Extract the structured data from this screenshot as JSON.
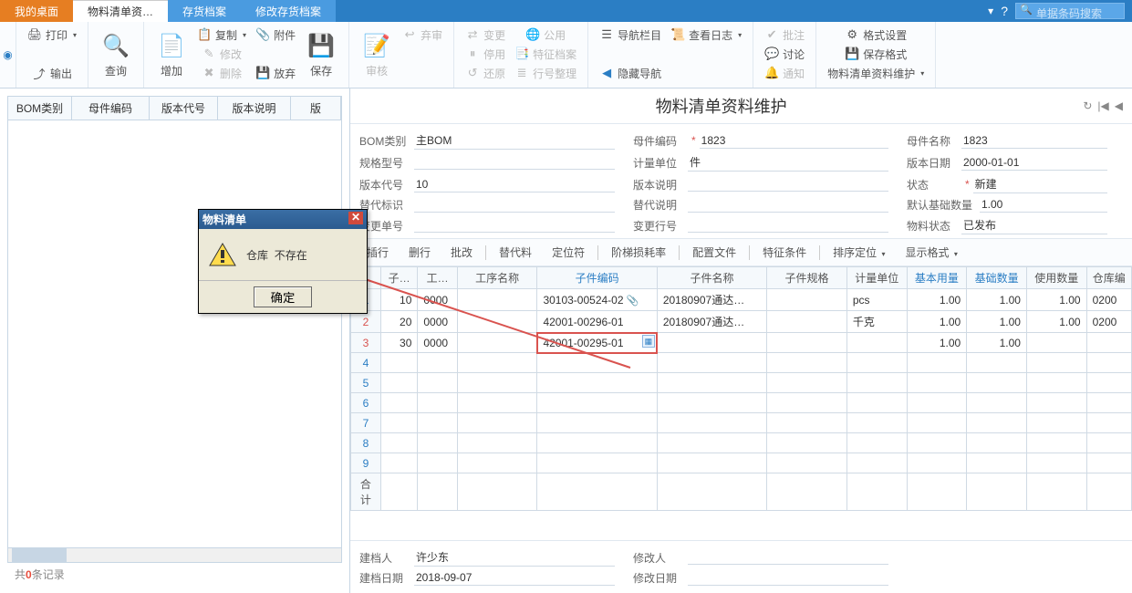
{
  "tabs": {
    "desktop": "我的桌面",
    "bom": "物料清单资…",
    "inventory": "存货档案",
    "modify_inventory": "修改存货档案"
  },
  "search_placeholder": "单据条码搜索",
  "ribbon": {
    "print": "打印",
    "output": "输出",
    "query": "查询",
    "add": "增加",
    "copy": "复制",
    "modify": "修改",
    "delete": "删除",
    "attach": "附件",
    "save": "保存",
    "abandon": "放弃",
    "audit": "审核",
    "discard": "弃审",
    "change": "变更",
    "stop": "停用",
    "restore": "还原",
    "public": "公用",
    "feature_file": "特征档案",
    "row_arrange": "行号整理",
    "nav_bar": "导航栏目",
    "view_log": "查看日志",
    "hide_nav": "隐藏导航",
    "batch_approve": "批注",
    "discuss": "讨论",
    "notify": "通知",
    "format_setting": "格式设置",
    "save_format": "保存格式",
    "bom_maintain": "物料清单资料维护"
  },
  "left_columns": {
    "bom_type": "BOM类别",
    "parent_code": "母件编码",
    "version_code": "版本代号",
    "version_desc": "版本说明",
    "ver": "版"
  },
  "left_footer": {
    "prefix": "共",
    "count": "0",
    "suffix": "条记录"
  },
  "dialog": {
    "title": "物料清单",
    "msg1": "仓库",
    "msg2": "不存在",
    "ok": "确定"
  },
  "page_title": "物料清单资料维护",
  "form": {
    "bom_type_label": "BOM类别",
    "bom_type_value": "主BOM",
    "parent_code_label": "母件编码",
    "parent_code_value": "1823",
    "parent_name_label": "母件名称",
    "parent_name_value": "1823",
    "spec_label": "规格型号",
    "unit_label": "计量单位",
    "unit_value": "件",
    "ver_date_label": "版本日期",
    "ver_date_value": "2000-01-01",
    "ver_code_label": "版本代号",
    "ver_code_value": "10",
    "ver_desc_label": "版本说明",
    "status_label": "状态",
    "status_value": "新建",
    "alt_label": "替代标识",
    "alt_desc_label": "替代说明",
    "base_qty_label": "默认基础数量",
    "base_qty_value": "1.00",
    "change_no_label": "变更单号",
    "change_row_label": "变更行号",
    "material_status_label": "物料状态",
    "material_status_value": "已发布"
  },
  "detail_toolbar": {
    "insert": "插行",
    "delete": "删行",
    "batch": "批改",
    "alt": "替代料",
    "locator": "定位符",
    "loss": "阶梯损耗率",
    "config": "配置文件",
    "feature": "特征条件",
    "sort": "排序定位",
    "display": "显示格式"
  },
  "detail_columns": {
    "child": "子…",
    "proc": "工…",
    "proc_name": "工序名称",
    "child_code": "子件编码",
    "child_name": "子件名称",
    "child_spec": "子件规格",
    "unit": "计量单位",
    "base_use": "基本用量",
    "base_qty": "基础数量",
    "use_qty": "使用数量",
    "wh_code": "仓库编"
  },
  "rows": [
    {
      "n": "1",
      "red": false,
      "c": "10",
      "p": "0000",
      "code": "30103-00524-02",
      "attach": true,
      "name": "20180907通达…",
      "unit": "pcs",
      "bu": "1.00",
      "bq": "1.00",
      "uq": "1.00",
      "wh": "0200"
    },
    {
      "n": "2",
      "red": true,
      "c": "20",
      "p": "0000",
      "code": "42001-00296-01",
      "attach": false,
      "name": "20180907通达…",
      "unit": "千克",
      "bu": "1.00",
      "bq": "1.00",
      "uq": "1.00",
      "wh": "0200"
    },
    {
      "n": "3",
      "red": true,
      "c": "30",
      "p": "0000",
      "code": "42001-00295-01",
      "attach": false,
      "name": "",
      "unit": "",
      "bu": "1.00",
      "bq": "1.00",
      "uq": "",
      "wh": "",
      "highlight": true
    }
  ],
  "empty_rows": [
    "4",
    "5",
    "6",
    "7",
    "8",
    "9"
  ],
  "sum_label": "合计",
  "footer": {
    "creator_label": "建档人",
    "creator": "许少东",
    "modifier_label": "修改人",
    "create_date_label": "建档日期",
    "create_date": "2018-09-07",
    "modify_date_label": "修改日期"
  }
}
